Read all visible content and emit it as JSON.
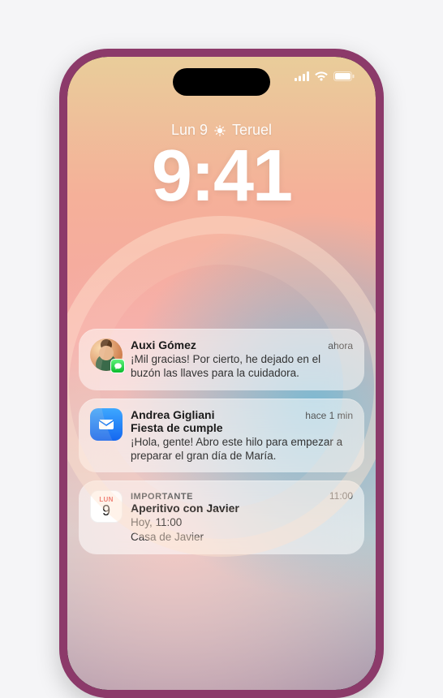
{
  "date_line": {
    "day": "Lun 9",
    "location": "Teruel"
  },
  "clock": "9:41",
  "calendar_icon": {
    "dow": "LUN",
    "dom": "9"
  },
  "notifications": [
    {
      "sender": "Auxi Gómez",
      "time": "ahora",
      "body": "¡Mil gracias! Por cierto, he dejado en el buzón las llaves para la cuidadora."
    },
    {
      "sender": "Andrea Gigliani",
      "subject": "Fiesta de cumple",
      "time": "hace 1 min",
      "body": "¡Hola, gente! Abro este hilo para empezar a preparar el gran día de María."
    },
    {
      "overline": "IMPORTANTE",
      "title": "Aperitivo con Javier",
      "time": "11:00",
      "line2": "Hoy, 11:00",
      "line3": "Casa de Javier"
    }
  ]
}
